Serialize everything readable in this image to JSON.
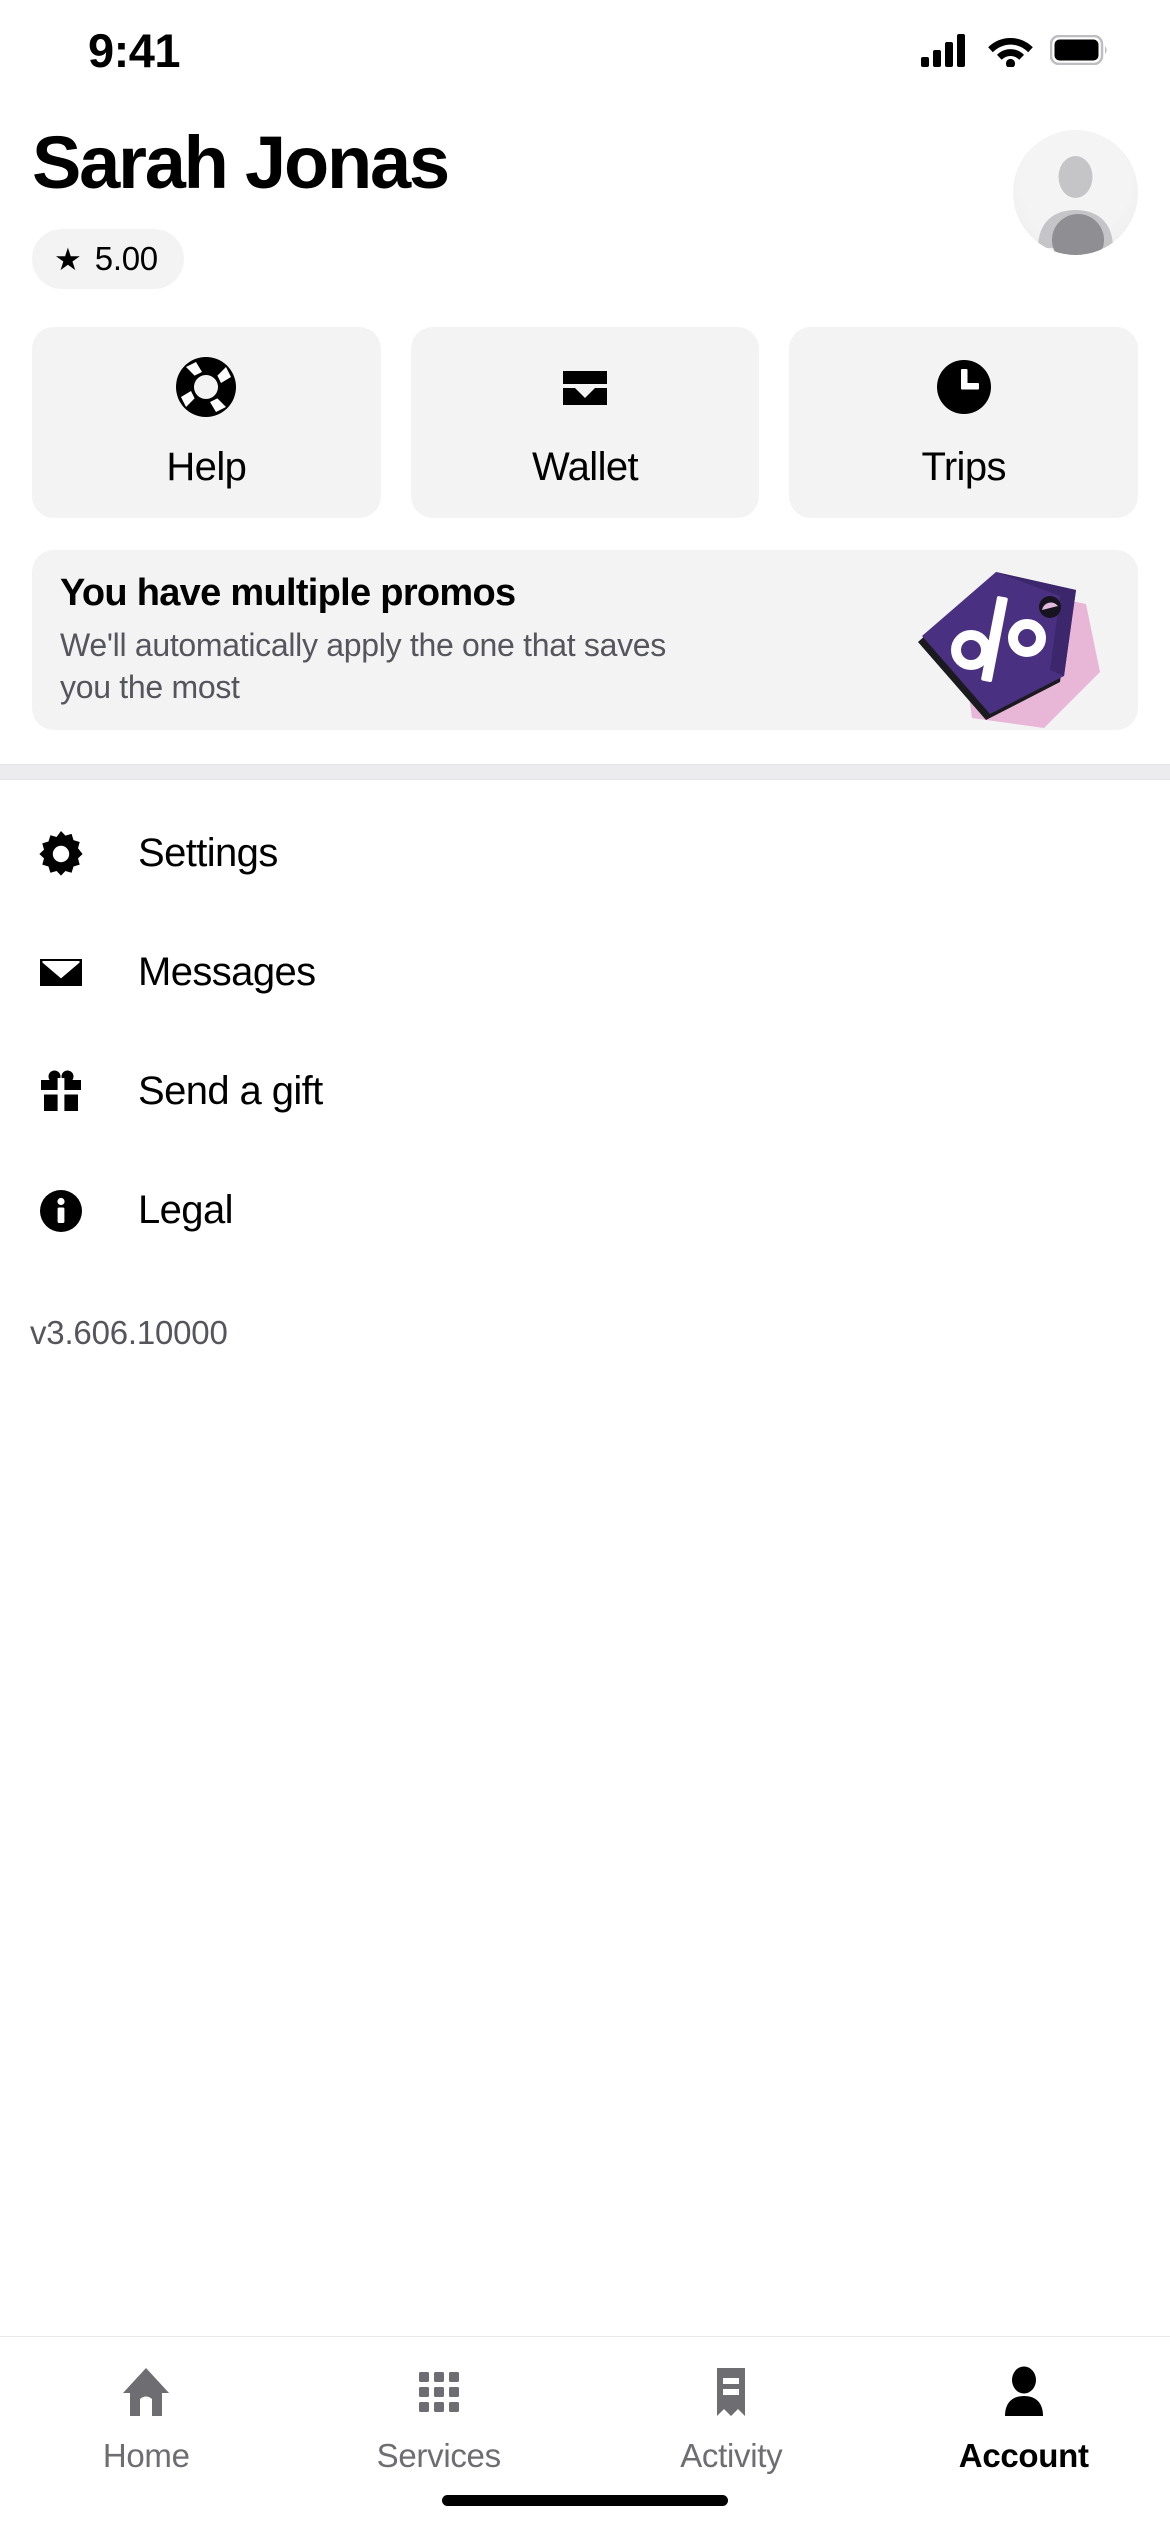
{
  "status_bar": {
    "time": "9:41",
    "icons": [
      "cellular-signal-icon",
      "wifi-icon",
      "battery-icon"
    ]
  },
  "header": {
    "profile_name": "Sarah Jonas",
    "rating": {
      "icon": "star-icon",
      "value": "5.00"
    },
    "avatar": {
      "icon": "person-placeholder-icon"
    }
  },
  "quick_actions": [
    {
      "label": "Help",
      "icon": "lifebuoy-icon"
    },
    {
      "label": "Wallet",
      "icon": "wallet-icon"
    },
    {
      "label": "Trips",
      "icon": "clock-icon"
    }
  ],
  "promo_card": {
    "title": "You have multiple promos",
    "subtitle": "We'll automatically apply the one that saves you the most",
    "illustration": "percent-tag-icon",
    "colors": {
      "tag_front": "#4a3080",
      "tag_back": "#e8b7d8",
      "card_bg": "#f3f3f4"
    }
  },
  "menu": [
    {
      "label": "Settings",
      "icon": "gear-icon"
    },
    {
      "label": "Messages",
      "icon": "envelope-icon"
    },
    {
      "label": "Send a gift",
      "icon": "gift-icon"
    },
    {
      "label": "Legal",
      "icon": "info-circle-icon"
    }
  ],
  "version": "v3.606.10000",
  "tab_bar": [
    {
      "label": "Home",
      "icon": "home-icon",
      "active": false
    },
    {
      "label": "Services",
      "icon": "grid-icon",
      "active": false
    },
    {
      "label": "Activity",
      "icon": "receipt-icon",
      "active": false
    },
    {
      "label": "Account",
      "icon": "person-icon",
      "active": true
    }
  ],
  "theme": {
    "accent": "#000000",
    "surface": "#f3f3f4",
    "muted_text": "#55555c"
  }
}
